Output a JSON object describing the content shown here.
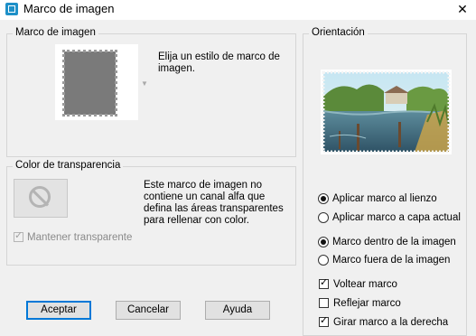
{
  "window": {
    "title": "Marco de imagen",
    "close_glyph": "✕",
    "app_icon": "frame-icon"
  },
  "frame_group": {
    "legend": "Marco de imagen",
    "description_line1": "Elija un estilo de marco de",
    "description_line2": "imagen."
  },
  "transparency_group": {
    "legend": "Color de transparencia",
    "message_line1": "Este marco de imagen no",
    "message_line2": "contiene un canal alfa que",
    "message_line3": "defina las áreas transparentes",
    "message_line4": "para rellenar con color.",
    "keep_transparent": {
      "label": "Mantener transparente",
      "checked": true,
      "disabled": true
    }
  },
  "orientation_group": {
    "legend": "Orientación",
    "apply_radio": [
      {
        "label": "Aplicar marco al lienzo",
        "selected": true
      },
      {
        "label": "Aplicar marco a capa actual",
        "selected": false
      }
    ],
    "position_radio": [
      {
        "label": "Marco dentro de la imagen",
        "selected": true
      },
      {
        "label": "Marco fuera de la imagen",
        "selected": false
      }
    ],
    "checkboxes": [
      {
        "label": "Voltear marco",
        "checked": true
      },
      {
        "label": "Reflejar marco",
        "checked": false
      },
      {
        "label": "Girar marco a la derecha",
        "checked": true
      }
    ]
  },
  "buttons": {
    "ok": "Aceptar",
    "cancel": "Cancelar",
    "help": "Ayuda"
  },
  "colors": {
    "accent": "#0078d7",
    "background": "#f0f0f0"
  }
}
